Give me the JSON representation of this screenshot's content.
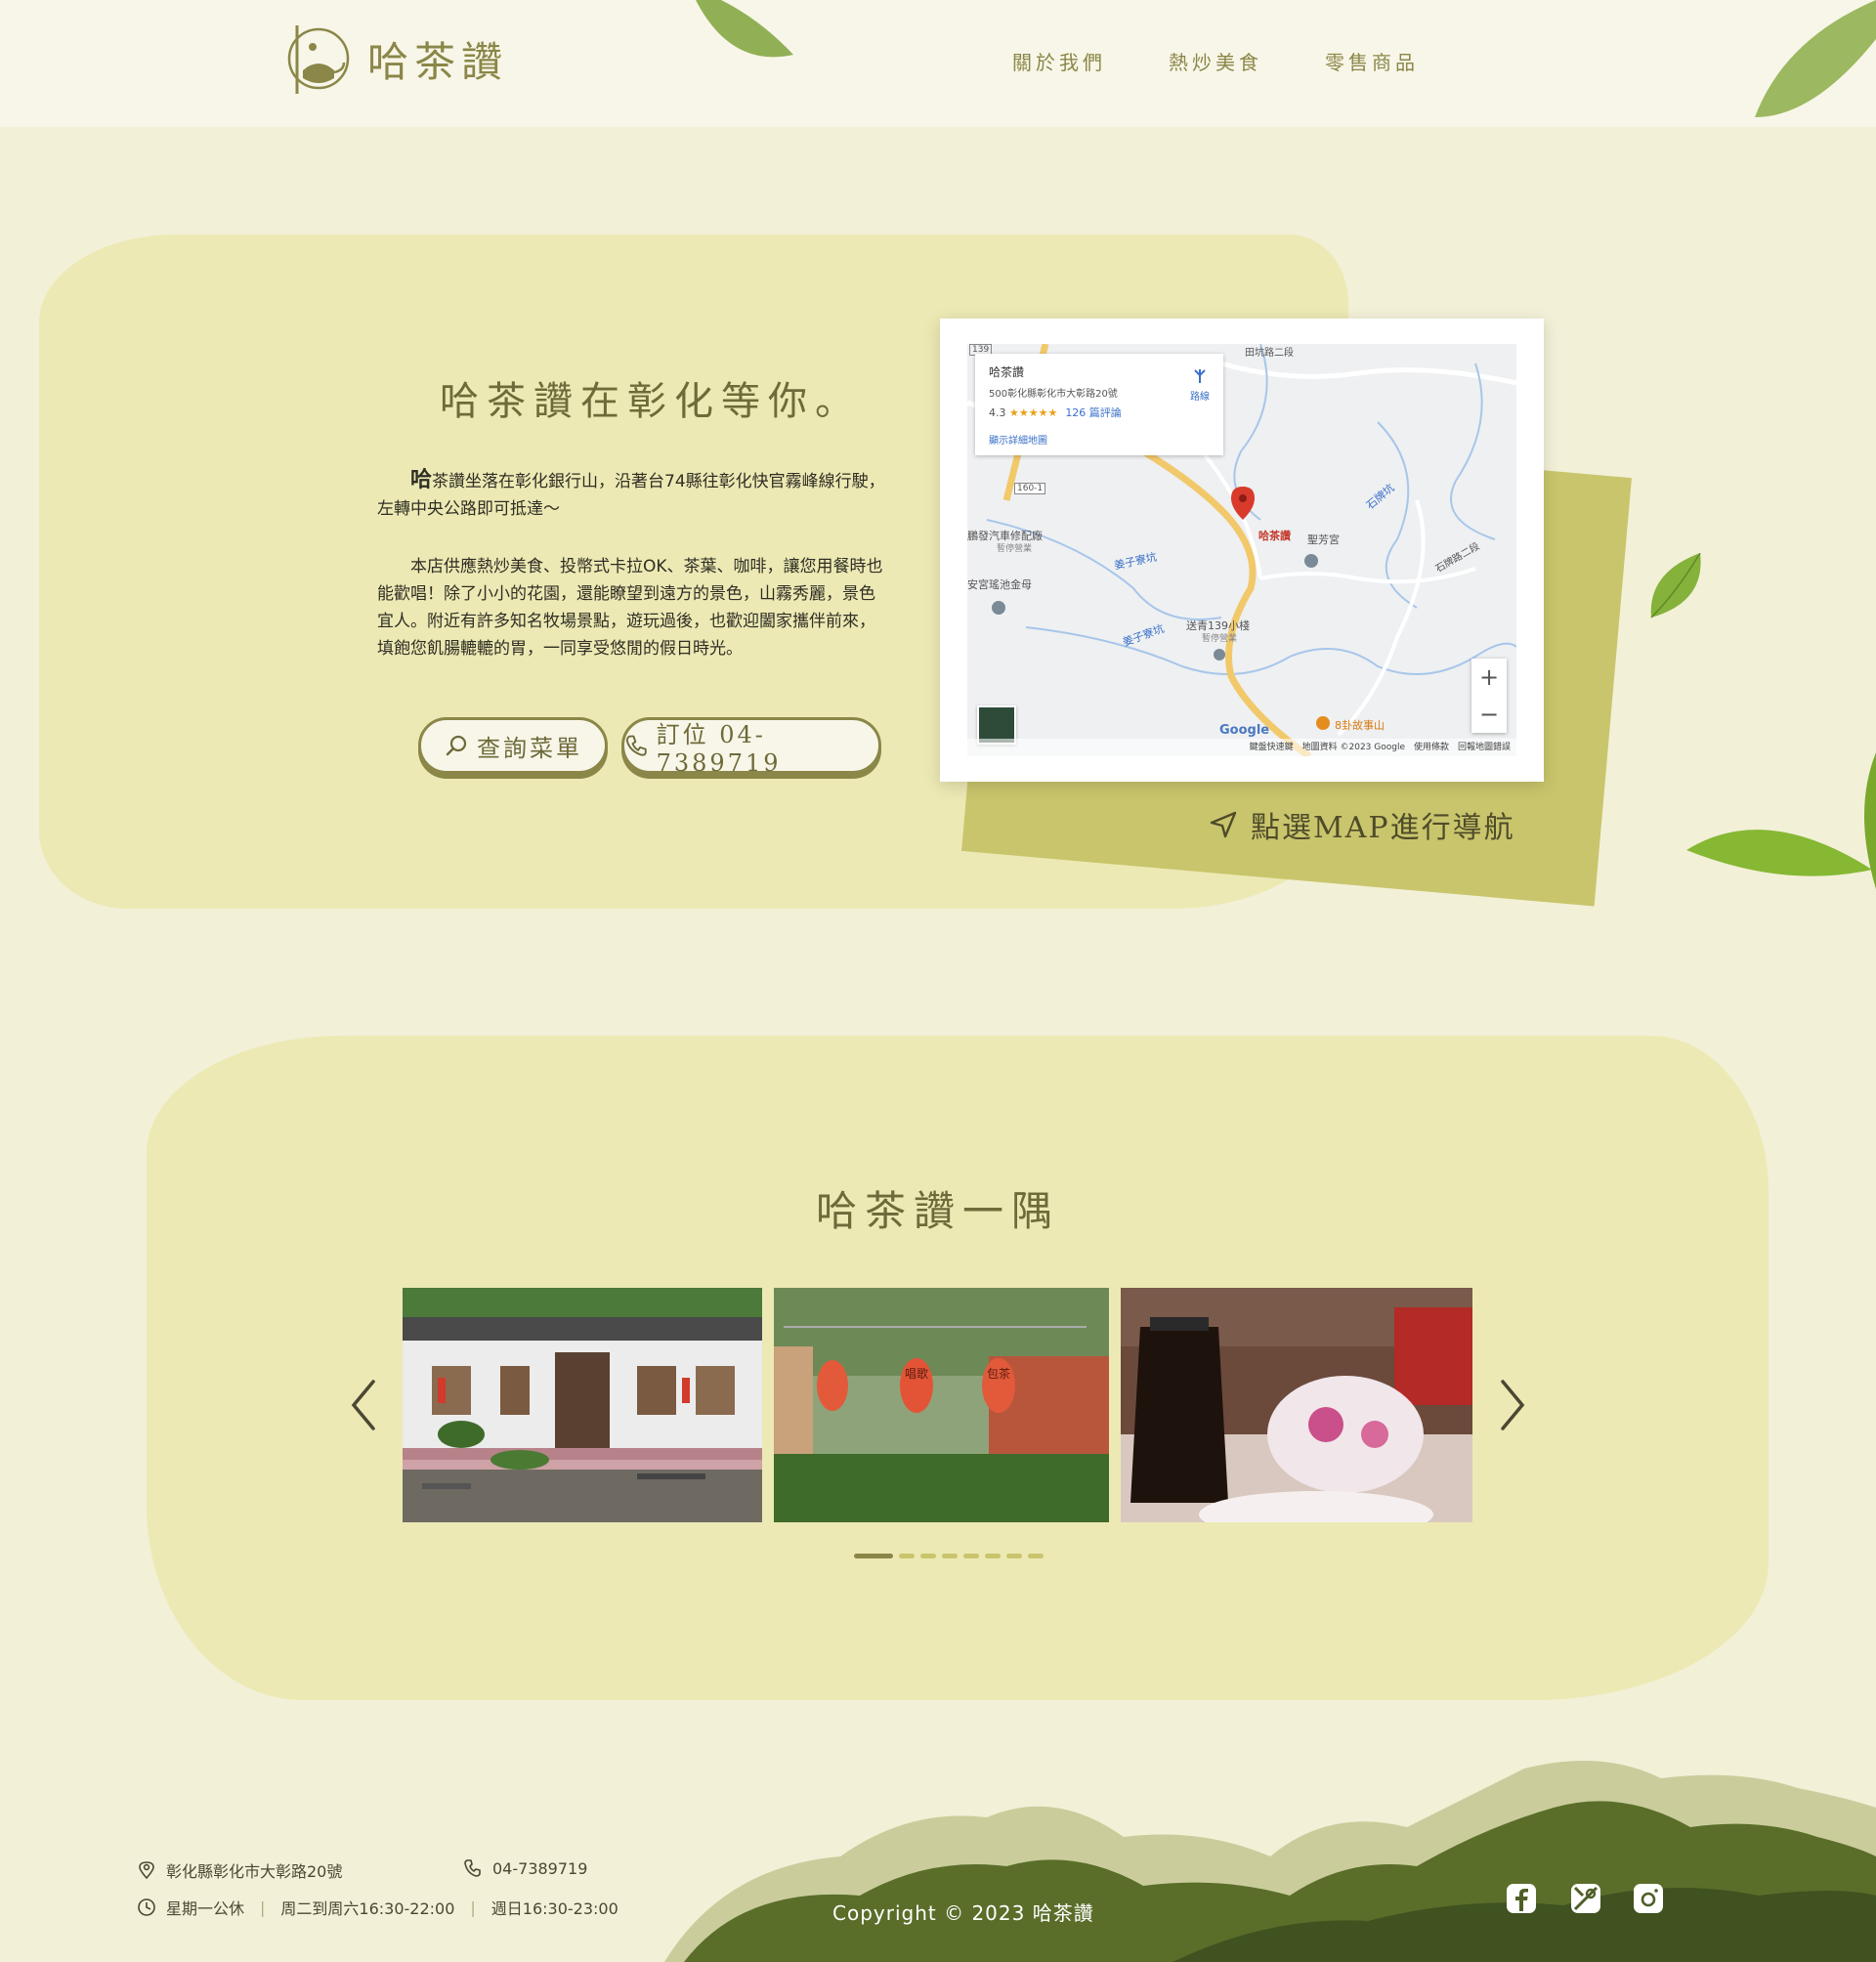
{
  "brand": {
    "name": "哈茶讚"
  },
  "nav": {
    "items": [
      "關於我們",
      "熱炒美食",
      "零售商品"
    ]
  },
  "intro": {
    "title": "哈茶讚在彰化等你。",
    "p1_first": "哈",
    "p1_rest": "茶讚坐落在彰化銀行山，沿著台74縣往彰化快官霧峰線行駛，左轉中央公路即可抵達～",
    "p2": "　　本店供應熱炒美食、投幣式卡拉OK、茶葉、咖啡，讓您用餐時也能歡唱！除了小小的花園，還能瞭望到遠方的景色，山霧秀麗，景色宜人。附近有許多知名牧場景點，遊玩過後，也歡迎闔家攜伴前來，填飽您飢腸轆轆的胃，一同享受悠閒的假日時光。",
    "menu_button": "查詢菜單",
    "call_button": "訂位 04-7389719"
  },
  "map": {
    "place_name": "哈茶讚",
    "address": "500彰化縣彰化市大彰路20號",
    "rating": "4.3",
    "stars": "★★★★★",
    "reviews": "126 篇評論",
    "directions": "路線",
    "larger_map": "顯示詳細地圖",
    "labels": {
      "road_139": "139",
      "road_tian": "田坑路二段",
      "road_160": "160-1",
      "shop": "鵬發汽車修配廠",
      "shop_sub": "暫停營業",
      "jiang1": "姜子寮坑",
      "jiang2": "姜子寮坑",
      "anguo": "安宮瑤池金母",
      "marker": "哈茶讚",
      "temple": "聖芳宮",
      "shipai": "石牌坑",
      "shipai_road": "石牌路二段",
      "inn": "送青139小棧",
      "inn_sub": "暫停營業",
      "bagua": "8卦故事山",
      "google": "Google"
    },
    "footer": "鍵盤快速鍵　地圖資料 ©2023 Google　使用條款　回報地圖錯誤",
    "zoom_in": "+",
    "zoom_out": "−",
    "navigate_text": "點選MAP進行導航"
  },
  "gallery": {
    "title": "哈茶讚一隅",
    "lantern1": "唱歌",
    "lantern2": "包茶",
    "dots": 8,
    "active_dot": 0
  },
  "footer": {
    "address": "彰化縣彰化市大彰路20號",
    "phone": "04-7389719",
    "hours_closed": "星期一公休",
    "hours_weekday": "周二到周六16:30-22:00",
    "hours_sunday": "週日16:30-23:00",
    "copyright": "Copyright © 2023 哈茶讚",
    "social": [
      "facebook-icon",
      "map-pin-icon",
      "instagram-icon"
    ]
  },
  "colors": {
    "accent": "#8a8748",
    "background": "#f3f0d8",
    "brush": "#ece9b4",
    "map_card_back": "#c9c56c",
    "mountain": "#5a6e2a"
  }
}
